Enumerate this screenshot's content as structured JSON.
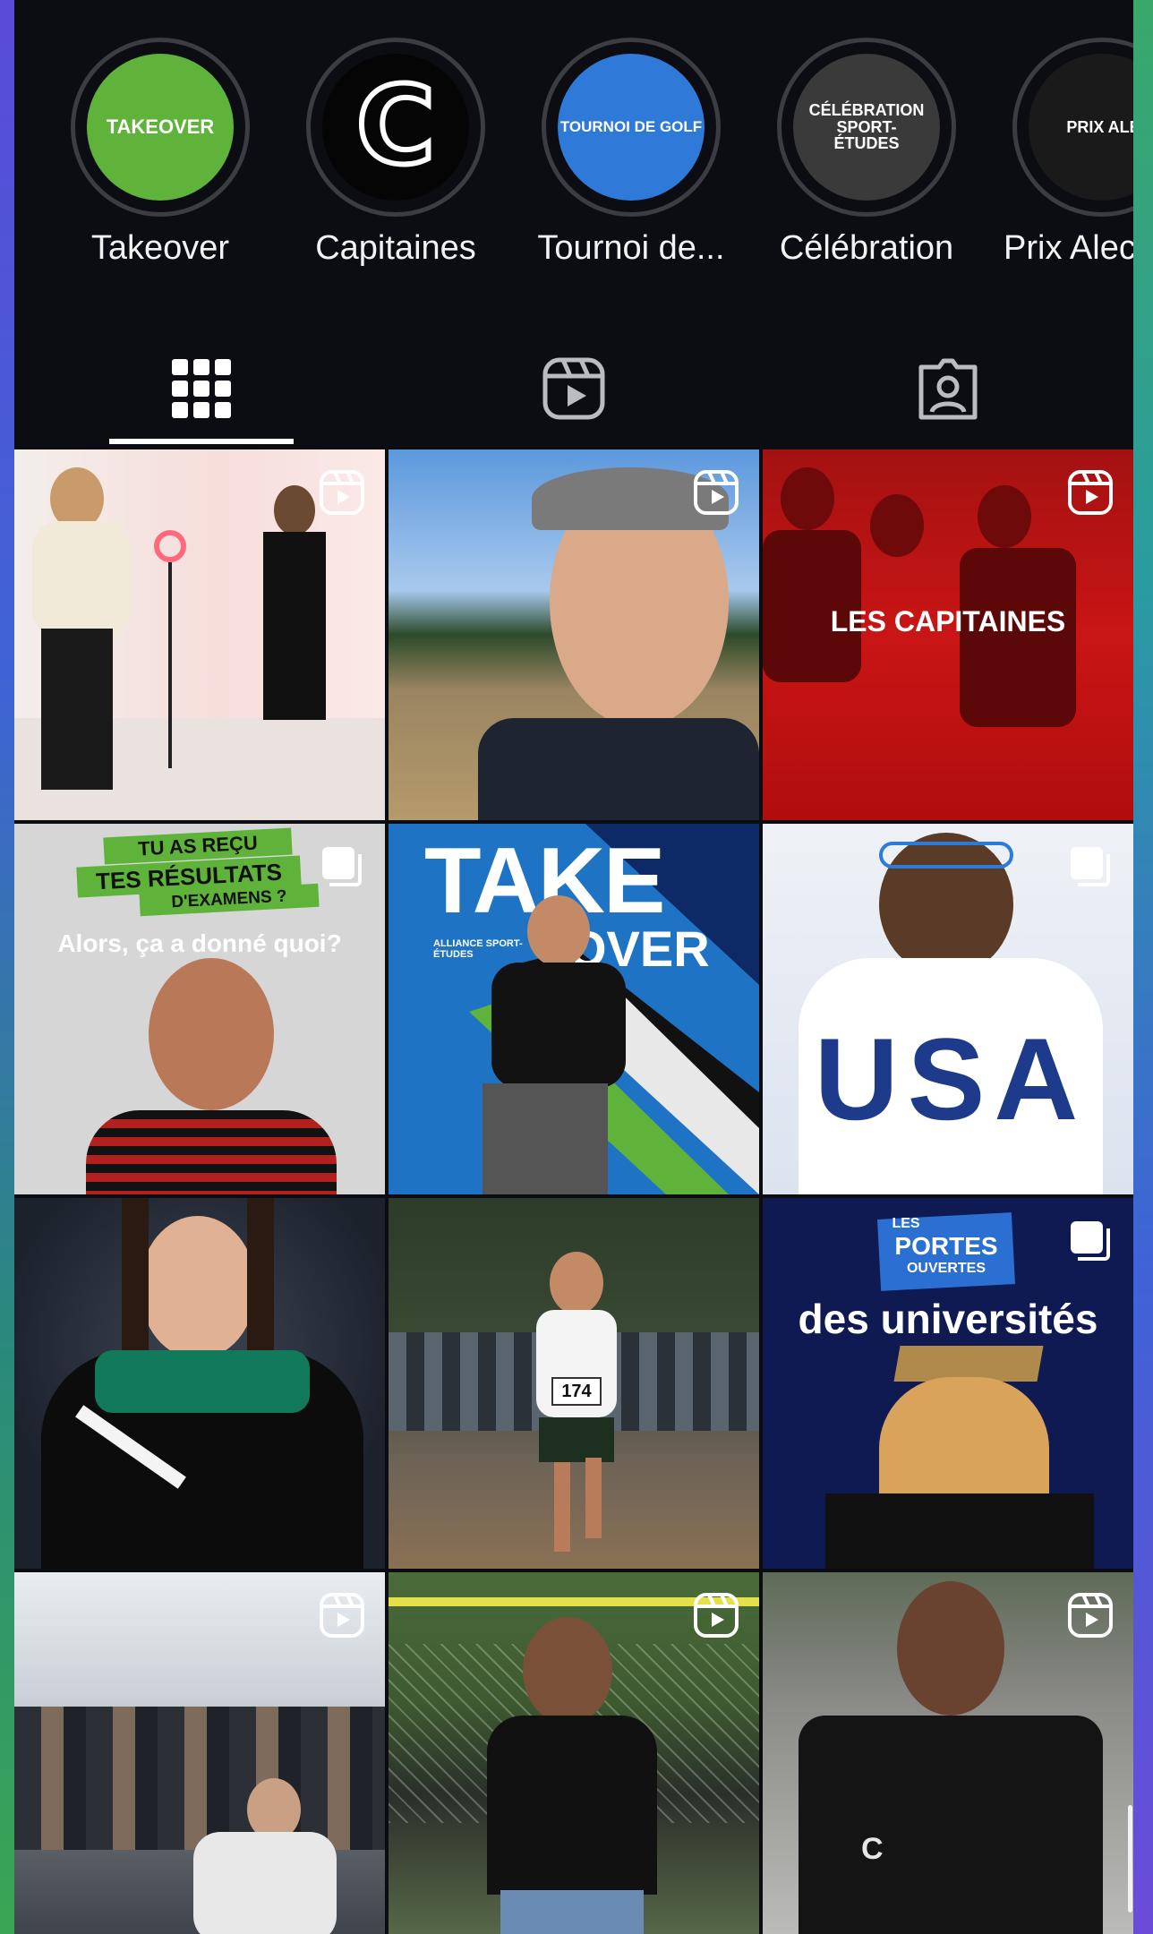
{
  "highlights": [
    {
      "label": "Takeover",
      "cover_text": "TAKEOVER",
      "cover_color": "#5fb33b"
    },
    {
      "label": "Capitaines",
      "cover_text": "C",
      "cover_color": "#050505"
    },
    {
      "label": "Tournoi de...",
      "cover_text": "TOURNOI DE GOLF",
      "cover_color": "#2f7ad8"
    },
    {
      "label": "Célébration",
      "cover_text": "CÉLÉBRATION SPORT-ÉTUDES",
      "cover_color": "#3a3a3a"
    },
    {
      "label": "Prix Alec-",
      "cover_text": "PRIX ALEC-RI",
      "cover_color": "#1a1a1a"
    }
  ],
  "tabs": [
    {
      "name": "grid",
      "icon": "grid-icon",
      "active": true
    },
    {
      "name": "reels",
      "icon": "reels-icon",
      "active": false
    },
    {
      "name": "tagged",
      "icon": "tagged-icon",
      "active": false
    }
  ],
  "posts": [
    {
      "type": "reel",
      "caption": "",
      "scene": "studio filming setup"
    },
    {
      "type": "reel",
      "caption": "",
      "scene": "selfie video outdoors"
    },
    {
      "type": "reel",
      "caption": "LES CAPITAINES",
      "scene": "team captains red overlay"
    },
    {
      "type": "carousel",
      "caption_top_1": "TU AS REÇU",
      "caption_top_2": "TES RÉSULTATS",
      "caption_top_3": "D'EXAMENS ?",
      "caption_sub": "Alors, ça a donné quoi?",
      "scene": "athlete portrait"
    },
    {
      "type": "image",
      "caption": "TAKE",
      "caption_2": "OVER",
      "logo_text": "ALLIANCE SPORT-ÉTUDES",
      "scene": "takeover athlete"
    },
    {
      "type": "carousel",
      "caption": "",
      "scene": "USA fan photo"
    },
    {
      "type": "image",
      "caption": "",
      "scene": "graduation portrait"
    },
    {
      "type": "image",
      "caption": "",
      "bib": "174",
      "scene": "cross country runner"
    },
    {
      "type": "carousel",
      "caption_small_1": "LES",
      "caption_small_2": "PORTES",
      "caption_small_3": "OUVERTES",
      "caption": "des universités",
      "scene": "graduate cap"
    },
    {
      "type": "reel",
      "caption": "",
      "scene": "conference room"
    },
    {
      "type": "reel",
      "caption": "",
      "scene": "athlete on field"
    },
    {
      "type": "reel",
      "caption": "",
      "scene": "athlete holding shirt"
    }
  ]
}
